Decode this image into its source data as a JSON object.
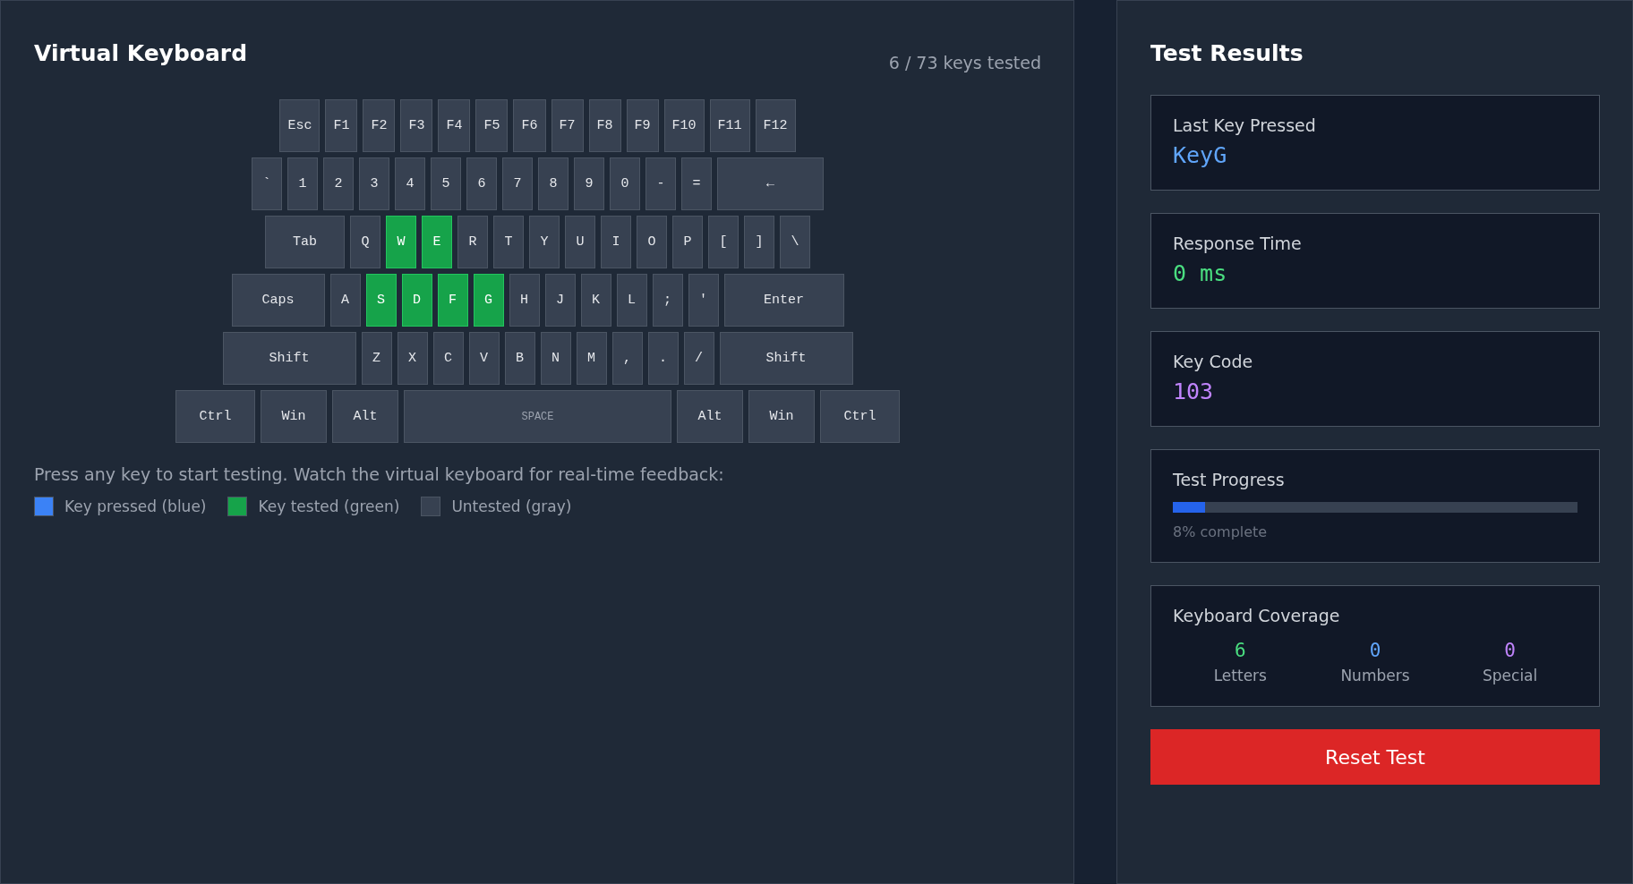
{
  "keyboard_panel": {
    "title": "Virtual Keyboard",
    "counter": "6 / 73 keys tested",
    "rows": [
      {
        "keys": [
          {
            "label": "Esc",
            "kind": "key",
            "tested": false
          },
          {
            "label": "F1",
            "kind": "key",
            "tested": false
          },
          {
            "label": "F2",
            "kind": "key",
            "tested": false
          },
          {
            "label": "F3",
            "kind": "key",
            "tested": false
          },
          {
            "label": "F4",
            "kind": "key",
            "tested": false
          },
          {
            "label": "F5",
            "kind": "key",
            "tested": false
          },
          {
            "label": "F6",
            "kind": "key",
            "tested": false
          },
          {
            "label": "F7",
            "kind": "key",
            "tested": false
          },
          {
            "label": "F8",
            "kind": "key",
            "tested": false
          },
          {
            "label": "F9",
            "kind": "key",
            "tested": false
          },
          {
            "label": "F10",
            "kind": "key",
            "tested": false
          },
          {
            "label": "F11",
            "kind": "key",
            "tested": false
          },
          {
            "label": "F12",
            "kind": "key",
            "tested": false
          }
        ]
      },
      {
        "keys": [
          {
            "label": "`",
            "kind": "key",
            "tested": false
          },
          {
            "label": "1",
            "kind": "key",
            "tested": false
          },
          {
            "label": "2",
            "kind": "key",
            "tested": false
          },
          {
            "label": "3",
            "kind": "key",
            "tested": false
          },
          {
            "label": "4",
            "kind": "key",
            "tested": false
          },
          {
            "label": "5",
            "kind": "key",
            "tested": false
          },
          {
            "label": "6",
            "kind": "key",
            "tested": false
          },
          {
            "label": "7",
            "kind": "key",
            "tested": false
          },
          {
            "label": "8",
            "kind": "key",
            "tested": false
          },
          {
            "label": "9",
            "kind": "key",
            "tested": false
          },
          {
            "label": "0",
            "kind": "key",
            "tested": false
          },
          {
            "label": "-",
            "kind": "key",
            "tested": false
          },
          {
            "label": "=",
            "kind": "key",
            "tested": false
          },
          {
            "label": "←",
            "kind": "backspace",
            "tested": false
          }
        ]
      },
      {
        "keys": [
          {
            "label": "Tab",
            "kind": "tab",
            "tested": false
          },
          {
            "label": "Q",
            "kind": "key",
            "tested": false
          },
          {
            "label": "W",
            "kind": "key",
            "tested": true
          },
          {
            "label": "E",
            "kind": "key",
            "tested": true
          },
          {
            "label": "R",
            "kind": "key",
            "tested": false
          },
          {
            "label": "T",
            "kind": "key",
            "tested": false
          },
          {
            "label": "Y",
            "kind": "key",
            "tested": false
          },
          {
            "label": "U",
            "kind": "key",
            "tested": false
          },
          {
            "label": "I",
            "kind": "key",
            "tested": false
          },
          {
            "label": "O",
            "kind": "key",
            "tested": false
          },
          {
            "label": "P",
            "kind": "key",
            "tested": false
          },
          {
            "label": "[",
            "kind": "key",
            "tested": false
          },
          {
            "label": "]",
            "kind": "key",
            "tested": false
          },
          {
            "label": "\\",
            "kind": "key",
            "tested": false
          }
        ]
      },
      {
        "keys": [
          {
            "label": "Caps",
            "kind": "caps",
            "tested": false
          },
          {
            "label": "A",
            "kind": "key",
            "tested": false
          },
          {
            "label": "S",
            "kind": "key",
            "tested": true
          },
          {
            "label": "D",
            "kind": "key",
            "tested": true
          },
          {
            "label": "F",
            "kind": "key",
            "tested": true
          },
          {
            "label": "G",
            "kind": "key",
            "tested": true
          },
          {
            "label": "H",
            "kind": "key",
            "tested": false
          },
          {
            "label": "J",
            "kind": "key",
            "tested": false
          },
          {
            "label": "K",
            "kind": "key",
            "tested": false
          },
          {
            "label": "L",
            "kind": "key",
            "tested": false
          },
          {
            "label": ";",
            "kind": "key",
            "tested": false
          },
          {
            "label": "'",
            "kind": "key",
            "tested": false
          },
          {
            "label": "Enter",
            "kind": "enter",
            "tested": false
          }
        ]
      },
      {
        "keys": [
          {
            "label": "Shift",
            "kind": "shift",
            "tested": false
          },
          {
            "label": "Z",
            "kind": "key",
            "tested": false
          },
          {
            "label": "X",
            "kind": "key",
            "tested": false
          },
          {
            "label": "C",
            "kind": "key",
            "tested": false
          },
          {
            "label": "V",
            "kind": "key",
            "tested": false
          },
          {
            "label": "B",
            "kind": "key",
            "tested": false
          },
          {
            "label": "N",
            "kind": "key",
            "tested": false
          },
          {
            "label": "M",
            "kind": "key",
            "tested": false
          },
          {
            "label": ",",
            "kind": "key",
            "tested": false
          },
          {
            "label": ".",
            "kind": "key",
            "tested": false
          },
          {
            "label": "/",
            "kind": "key",
            "tested": false
          },
          {
            "label": "Shift",
            "kind": "shift",
            "tested": false
          }
        ]
      },
      {
        "keys": [
          {
            "label": "Ctrl",
            "kind": "ctrl",
            "tested": false
          },
          {
            "label": "Win",
            "kind": "mod",
            "tested": false
          },
          {
            "label": "Alt",
            "kind": "mod",
            "tested": false
          },
          {
            "label": "SPACE",
            "kind": "space",
            "tested": false
          },
          {
            "label": "Alt",
            "kind": "mod",
            "tested": false
          },
          {
            "label": "Win",
            "kind": "mod",
            "tested": false
          },
          {
            "label": "Ctrl",
            "kind": "ctrl",
            "tested": false
          }
        ]
      }
    ],
    "instructions": "Press any key to start testing. Watch the virtual keyboard for real-time feedback:",
    "legend": [
      {
        "label": "Key pressed (blue)",
        "color": "#3b82f6"
      },
      {
        "label": "Key tested (green)",
        "color": "#16a34a"
      },
      {
        "label": "Untested (gray)",
        "color": "#374151"
      }
    ]
  },
  "results_panel": {
    "title": "Test Results",
    "cards": [
      {
        "kind": "value",
        "label": "Last Key Pressed",
        "value": "KeyG",
        "color": "#60a5fa"
      },
      {
        "kind": "value",
        "label": "Response Time",
        "value": "0 ms",
        "color": "#4ade80"
      },
      {
        "kind": "value",
        "label": "Key Code",
        "value": "103",
        "color": "#c084fc"
      },
      {
        "kind": "progress",
        "label": "Test Progress",
        "level": 0.08,
        "caption": "8% complete"
      },
      {
        "kind": "coverage",
        "label": "Keyboard Coverage",
        "stats": [
          {
            "value": "6",
            "label": "Letters",
            "color": "#4ade80"
          },
          {
            "value": "0",
            "label": "Numbers",
            "color": "#60a5fa"
          },
          {
            "value": "0",
            "label": "Special",
            "color": "#c084fc"
          }
        ]
      }
    ],
    "reset_button": "Reset Test"
  }
}
